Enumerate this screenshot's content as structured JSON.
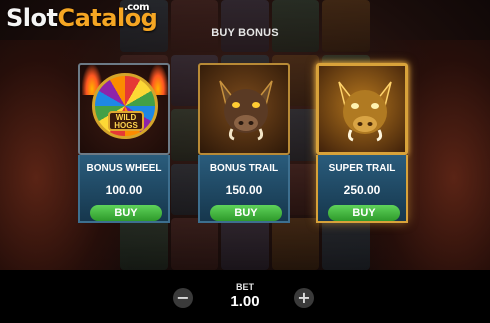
{
  "watermark": {
    "brand_prefix": "Slot",
    "brand_suffix": "Catalog",
    "domain": ".com"
  },
  "dialog": {
    "title": "BUY BONUS"
  },
  "cards": [
    {
      "name": "BONUS WHEEL",
      "price": "100.00",
      "buy_label": "BUY",
      "wheel_text": "WILD HOGS"
    },
    {
      "name": "BONUS TRAIL",
      "price": "150.00",
      "buy_label": "BUY"
    },
    {
      "name": "SUPER TRAIL",
      "price": "250.00",
      "buy_label": "BUY"
    }
  ],
  "bet": {
    "label": "BET",
    "value": "1.00"
  },
  "controls": {
    "minus": "−",
    "plus": "+"
  },
  "colors": {
    "buy_green": "#3fb83b",
    "panel_blue": "#1f4a66",
    "gold_frame": "#d8a23a"
  }
}
